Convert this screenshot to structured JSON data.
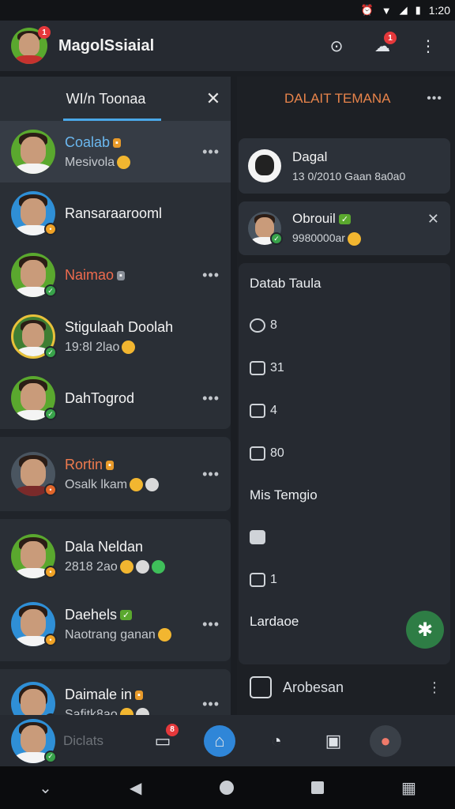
{
  "statusbar": {
    "time": "1:20"
  },
  "appbar": {
    "title": "MagolSsiaial",
    "search_badge": "",
    "notif_badge": "1",
    "avatar_badge": "1"
  },
  "left_panel": {
    "tab_title": "WI/n Toonaa",
    "contacts": [
      {
        "name": "Coalab",
        "msg": "Mesivola",
        "active": true
      },
      {
        "name": "Ransaraarooml",
        "msg": ""
      },
      {
        "name": "Naimao",
        "msg": ""
      },
      {
        "name": "Stigulaah Doolah",
        "msg": "19:8l 2lao"
      },
      {
        "name": "DahTogrod",
        "msg": ""
      },
      {
        "name": "Rortin",
        "msg": "Osalk lkam"
      },
      {
        "name": "Dala Neldan",
        "msg": "2818 2ao"
      },
      {
        "name": "Daehels",
        "msg": "Naotrang ganan"
      },
      {
        "name": "Daimale in",
        "msg": "Safitk8ao"
      }
    ]
  },
  "right_panel": {
    "title": "DALAIT TEMANA",
    "card1": {
      "title": "Dagal",
      "sub": "13 0/2010 Gaan 8a0a0"
    },
    "card2": {
      "title": "Obrouil",
      "sub": "9980000ar"
    },
    "section_title": "Datab Taula",
    "rows": [
      "8",
      "31",
      "4",
      "80"
    ],
    "section2_title": "Mis Temgio",
    "rows2": [
      "",
      "1"
    ],
    "section3_title": "Lardaoe",
    "footer_label": "Arobesan"
  },
  "bottomnav": {
    "me_label": "Diclats",
    "msg_badge": "8"
  },
  "colors": {
    "accent_blue": "#4aa8e8",
    "accent_orange": "#e8844b",
    "fab_green": "#2e7d45",
    "badge_red": "#e5383b"
  }
}
